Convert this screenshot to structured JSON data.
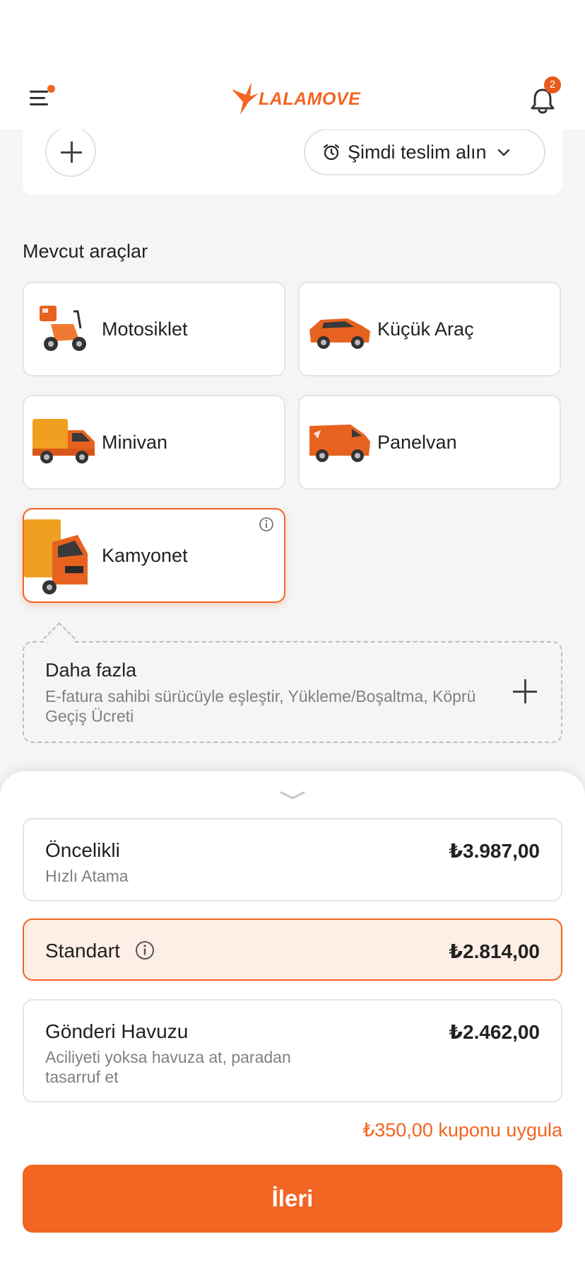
{
  "header": {
    "logo_text": "LALAMOVE",
    "notification_count": "2"
  },
  "top_card": {
    "deliver_label": "Şimdi teslim alın"
  },
  "vehicles": {
    "section_title": "Mevcut araçlar",
    "items": [
      {
        "label": "Motosiklet",
        "icon": "motorcycle-icon"
      },
      {
        "label": "Küçük Araç",
        "icon": "car-icon"
      },
      {
        "label": "Minivan",
        "icon": "minivan-icon"
      },
      {
        "label": "Panelvan",
        "icon": "panelvan-icon"
      },
      {
        "label": "Kamyonet",
        "icon": "truck-icon",
        "selected": true
      }
    ]
  },
  "more": {
    "title": "Daha fazla",
    "description": "E-fatura sahibi sürücüyle eşleştir, Yükleme/Boşaltma, Köprü Geçiş Ücreti"
  },
  "pricing": {
    "options": [
      {
        "title": "Öncelikli",
        "subtitle": "Hızlı Atama",
        "price": "₺3.987,00"
      },
      {
        "title": "Standart",
        "subtitle": "",
        "price": "₺2.814,00",
        "selected": true
      },
      {
        "title": "Gönderi Havuzu",
        "subtitle": "Aciliyeti yoksa havuza at, paradan tasarruf et",
        "price": "₺2.462,00"
      }
    ],
    "coupon_text": "₺350,00 kuponu uygula",
    "next_label": "İleri"
  },
  "colors": {
    "accent": "#f26522",
    "selected_bg": "#fdeee6"
  }
}
